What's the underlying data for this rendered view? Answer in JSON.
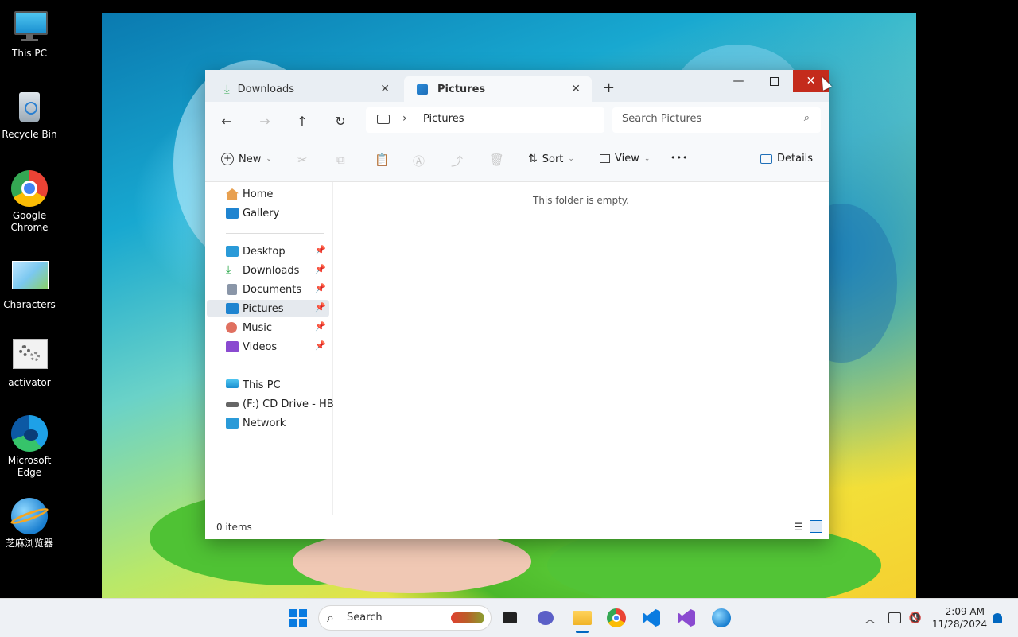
{
  "desktop": {
    "icons": [
      {
        "label": "This PC"
      },
      {
        "label": "Recycle Bin"
      },
      {
        "label_line1": "Google",
        "label_line2": "Chrome"
      },
      {
        "label": "Characters"
      },
      {
        "label": "activator"
      },
      {
        "label_line1": "Microsoft",
        "label_line2": "Edge"
      },
      {
        "label": "芝麻浏览器"
      }
    ]
  },
  "explorer": {
    "tabs": [
      {
        "label": "Downloads",
        "icon": "download-icon",
        "active": false
      },
      {
        "label": "Pictures",
        "icon": "pictures-icon",
        "active": true
      }
    ],
    "new_tab_label": "+",
    "address": {
      "location": "Pictures"
    },
    "search": {
      "placeholder": "Search Pictures"
    },
    "toolbar": {
      "new_label": "New",
      "sort_label": "Sort",
      "view_label": "View",
      "more_label": "•••",
      "details_label": "Details"
    },
    "nav": {
      "home": "Home",
      "gallery": "Gallery",
      "quick_access": [
        {
          "label": "Desktop",
          "color": "#2a9ad8"
        },
        {
          "label": "Downloads",
          "color": "#2aa84a"
        },
        {
          "label": "Documents",
          "color": "#8a96a8"
        },
        {
          "label": "Pictures",
          "color": "#1f84d0"
        },
        {
          "label": "Music",
          "color": "#e07060"
        },
        {
          "label": "Videos",
          "color": "#8a4ad0"
        }
      ],
      "selected": "Pictures",
      "this_pc": "This PC",
      "cd_drive": "(F:) CD Drive - HBCD",
      "network": "Network"
    },
    "content": {
      "empty_message": "This folder is empty."
    },
    "status": {
      "items_count": "0 items"
    }
  },
  "taskbar": {
    "search_label": "Search",
    "time": "2:09 AM",
    "date": "11/28/2024"
  },
  "colors": {
    "close_hover": "#c42b1c",
    "selection": "#e5e9ee",
    "accent": "#0067c0"
  }
}
